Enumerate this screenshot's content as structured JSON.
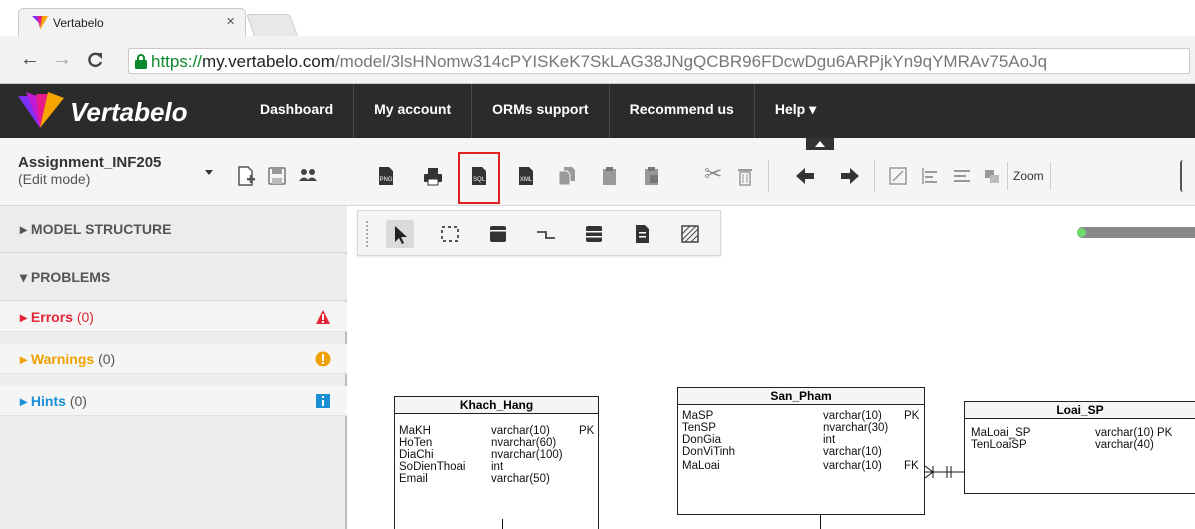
{
  "browser": {
    "tab_title": "Vertabelo",
    "tab_close": "×",
    "url_protocol": "https://",
    "url_host": "my.vertabelo.com",
    "url_path": "/model/3lsHNomw314cPYISKeK7SkLAG38JNgQCBR96FDcwDgu6ARPjkYn9qYMRAv75AoJq"
  },
  "app": {
    "brand": "Vertabelo",
    "nav": [
      "Dashboard",
      "My account",
      "ORMs support",
      "Recommend us",
      "Help ▾"
    ]
  },
  "toolbar": {
    "model_name": "Assignment_INF205",
    "model_mode": "(Edit mode)",
    "zoom_label": "Zoom",
    "highlighted_button": "sql-export-icon"
  },
  "left_panel": {
    "model_structure": "MODEL STRUCTURE",
    "problems": "PROBLEMS",
    "errors_label": "Errors",
    "errors_count": "(0)",
    "warnings_label": "Warnings",
    "warnings_count": "(0)",
    "hints_label": "Hints",
    "hints_count": "(0)",
    "colors": {
      "errors": "#e32636",
      "warnings": "#f0a000",
      "hints": "#1a8fd6"
    }
  },
  "diagram": {
    "tables": [
      {
        "name": "Khach_Hang",
        "columns": [
          [
            "MaKH",
            "varchar(10)",
            "PK"
          ],
          [
            "HoTen",
            "nvarchar(60)",
            ""
          ],
          [
            "DiaChi",
            "nvarchar(100)",
            ""
          ],
          [
            "SoDienThoai",
            "int",
            ""
          ],
          [
            "Email",
            "varchar(50)",
            ""
          ]
        ]
      },
      {
        "name": "San_Pham",
        "columns": [
          [
            "MaSP",
            "varchar(10)",
            "PK"
          ],
          [
            "TenSP",
            "nvarchar(30)",
            ""
          ],
          [
            "DonGia",
            "int",
            ""
          ],
          [
            "DonViTinh",
            "varchar(10)",
            ""
          ],
          [
            "MaLoai",
            "varchar(10)",
            "FK"
          ]
        ]
      },
      {
        "name": "Loai_SP",
        "columns": [
          [
            "MaLoai_SP",
            "varchar(10) PK",
            ""
          ],
          [
            "TenLoaiSP",
            "varchar(40)",
            ""
          ]
        ]
      }
    ]
  }
}
